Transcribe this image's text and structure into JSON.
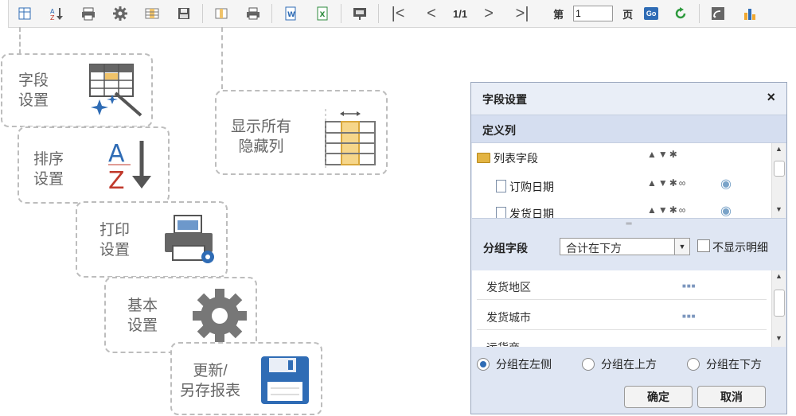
{
  "toolbar": {
    "page_indicator": "1/1",
    "page_prefix": "第",
    "page_value": "1",
    "page_suffix": "页",
    "go_label": "Go"
  },
  "callouts": {
    "field_settings": "字段\n设置",
    "sort_settings": "排序\n设置",
    "print_settings": "打印\n设置",
    "basic_settings": "基本\n设置",
    "update_save": "更新/\n另存报表",
    "show_hidden": "显示所有\n隐藏列"
  },
  "dialog": {
    "title": "字段设置",
    "close": "×",
    "define_columns": "定义列",
    "columns": [
      {
        "name": "列表字段",
        "type": "folder"
      },
      {
        "name": "订购日期",
        "type": "doc"
      },
      {
        "name": "发货日期",
        "type": "doc"
      }
    ],
    "group_label": "分组字段",
    "group_select": "合计在下方",
    "hide_detail": "不显示明细",
    "group_fields": [
      "发货地区",
      "发货城市",
      "运货商"
    ],
    "radios": [
      {
        "label": "分组在左侧",
        "checked": true
      },
      {
        "label": "分组在上方",
        "checked": false
      },
      {
        "label": "分组在下方",
        "checked": false
      }
    ],
    "ok": "确定",
    "cancel": "取消"
  }
}
